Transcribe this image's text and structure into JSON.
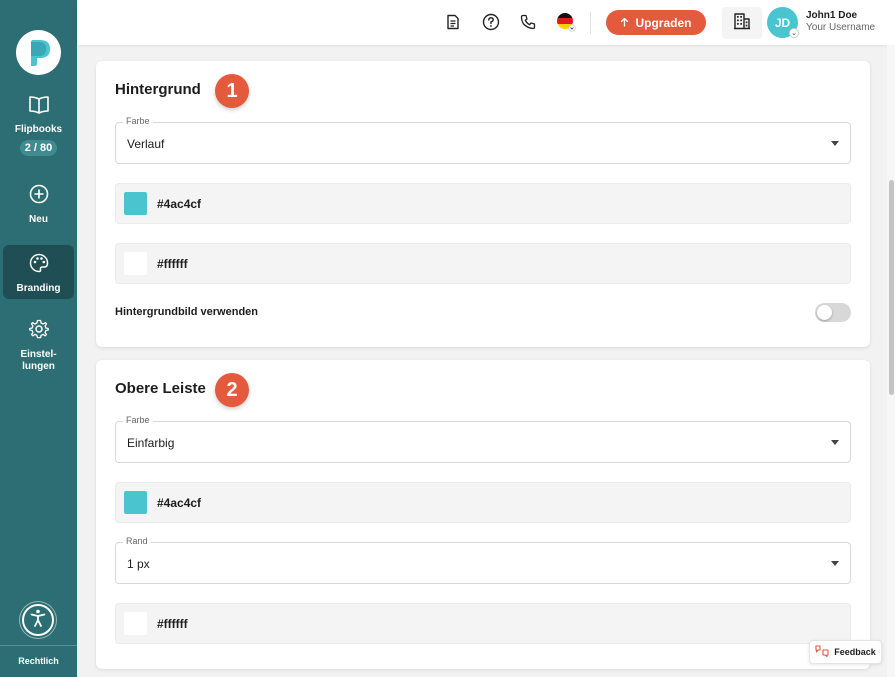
{
  "sidebar": {
    "logo_icon": "flipbook-p-logo",
    "items": [
      {
        "label": "Flipbooks",
        "badge": "2 / 80",
        "icon": "book-open-icon"
      },
      {
        "label": "Neu",
        "icon": "plus-circle-icon"
      },
      {
        "label": "Branding",
        "icon": "palette-icon",
        "active": true
      },
      {
        "label": "Einstel-lungen",
        "line1": "Einstel-",
        "line2": "lungen",
        "icon": "gear-icon"
      }
    ],
    "accessibility_icon": "accessibility-icon",
    "footer_label": "Rechtlich"
  },
  "header": {
    "icons": [
      "document-icon",
      "help-icon",
      "phone-icon",
      "german-flag-icon"
    ],
    "upgrade_label": "Upgraden",
    "company_icon": "building-icon",
    "avatar_initials": "JD",
    "user_name": "John1 Doe",
    "user_subtitle": "Your Username"
  },
  "sections": {
    "background": {
      "title": "Hintergrund",
      "step": "1",
      "color_select": {
        "label": "Farbe",
        "value": "Verlauf"
      },
      "color1": "#4ac4cf",
      "color2": "#ffffff",
      "toggle_label": "Hintergrundbild verwenden",
      "toggle_on": false
    },
    "top_bar": {
      "title": "Obere Leiste",
      "step": "2",
      "color_select": {
        "label": "Farbe",
        "value": "Einfarbig"
      },
      "color1": "#4ac4cf",
      "border_select": {
        "label": "Rand",
        "value": "1 px"
      },
      "color2": "#ffffff"
    }
  },
  "feedback_label": "Feedback",
  "colors": {
    "sidebar": "#2c6e73",
    "sidebar_active": "#1f4f55",
    "accent": "#e35a3c",
    "brand_teal": "#4ac4cf"
  }
}
